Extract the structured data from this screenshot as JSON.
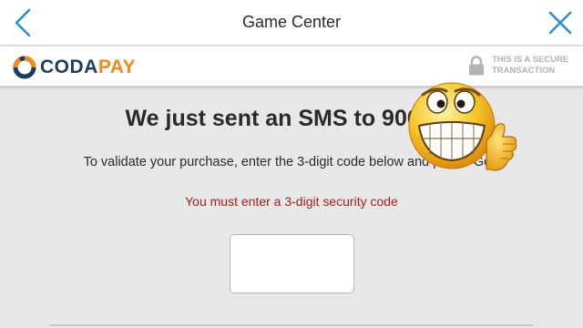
{
  "header": {
    "title": "Game Center"
  },
  "brand": {
    "name_part1": "CODA",
    "name_part2": "PAY",
    "colors": {
      "navy": "#1e3d5c",
      "orange": "#f08a1c"
    }
  },
  "secure_badge": {
    "text": "THIS IS A SECURE TRANSACTION"
  },
  "main": {
    "headline": "We just sent an SMS to 906934",
    "instruction": "To validate your purchase, enter the 3-digit code below and press \"Go!\"",
    "error": "You must enter a 3-digit security code",
    "code_input_value": ""
  },
  "icons": {
    "back": "chevron-left-icon",
    "close": "close-icon",
    "lock": "lock-icon",
    "overlay": "grinning-thumbs-up-emoji"
  },
  "accent_color": "#2a8fd1",
  "error_color": "#a5201b"
}
